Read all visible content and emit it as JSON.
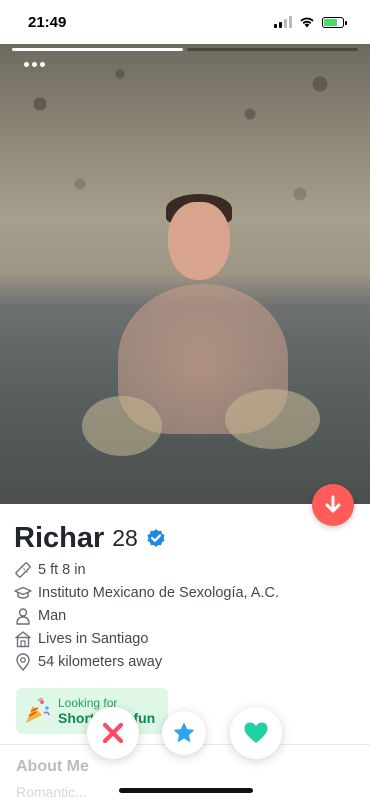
{
  "status_bar": {
    "time": "21:49"
  },
  "profile": {
    "name": "Richar",
    "age": "28",
    "details": {
      "height": "5 ft 8 in",
      "school": "Instituto Mexicano de Sexología, A.C.",
      "gender": "Man",
      "lives_in": "Lives in Santiago",
      "distance": "54 kilometers away"
    },
    "looking_for": {
      "label": "Looking for",
      "value": "Short-term fun"
    },
    "about_title": "About Me",
    "about_preview": "Romantic..."
  },
  "photo": {
    "total": 2,
    "active_index": 0
  },
  "colors": {
    "nope": "#fe4a64",
    "super_like": "#2fa4f0",
    "like": "#1fd1a3",
    "collapse": "#fe5b59",
    "verified": "#1e88e5"
  },
  "icons": {
    "more": "more-dots-icon",
    "collapse": "arrow-down-icon",
    "height": "ruler-icon",
    "school": "graduation-cap-icon",
    "gender": "person-icon",
    "lives_in": "home-icon",
    "distance": "location-pin-icon",
    "looking_for": "party-popper-icon",
    "nope": "close-icon",
    "super_like": "star-icon",
    "like": "heart-icon"
  }
}
